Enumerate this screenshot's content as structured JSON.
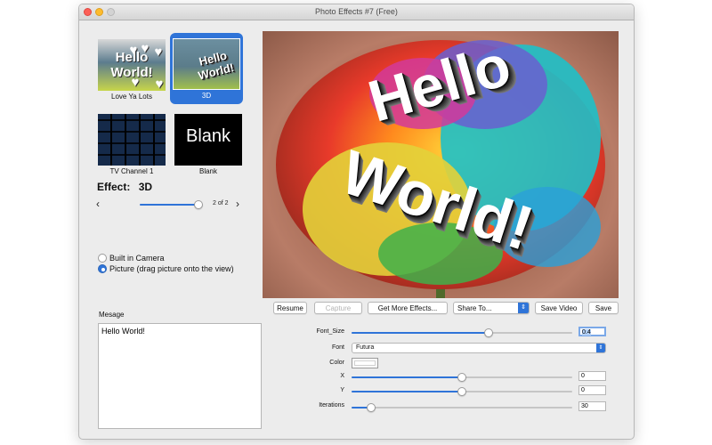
{
  "window": {
    "title": "Photo Effects #7 (Free)"
  },
  "effects": {
    "items": [
      {
        "label": "Love Ya Lots",
        "thumb_text": "Hello World!"
      },
      {
        "label": "3D",
        "thumb_text": "Hello World!"
      },
      {
        "label": "TV Channel 1"
      },
      {
        "label": "Blank",
        "thumb_text": "Blank"
      }
    ],
    "selected_index": 1,
    "current_label": "Effect:",
    "current_value": "3D",
    "counter": "2 of 2",
    "slider_level": 1.0,
    "prev_icon": "chevron-left-icon",
    "next_icon": "chevron-right-icon"
  },
  "source": {
    "options": [
      "Built in Camera",
      "Picture (drag picture onto the view)"
    ],
    "selected_index": 1
  },
  "message": {
    "label": "Mesage",
    "value": "Hello World!"
  },
  "preview": {
    "text_line1": "Hello",
    "text_line2": "World!"
  },
  "toolbar": {
    "resume": "Resume",
    "capture": "Capture",
    "get_more": "Get More Effects...",
    "share": "Share To...",
    "save_video": "Save Video",
    "save": "Save"
  },
  "params": {
    "font_size": {
      "label": "Font_Size",
      "value": "0.4",
      "level": 0.62
    },
    "font": {
      "label": "Font",
      "value": "Futura"
    },
    "color": {
      "label": "Color",
      "value": "#ffffff"
    },
    "x": {
      "label": "X",
      "value": "0",
      "level": 0.5
    },
    "y": {
      "label": "Y",
      "value": "0",
      "level": 0.5
    },
    "iterations": {
      "label": "Iterations",
      "value": "30",
      "level": 0.09
    }
  },
  "colors": {
    "accent": "#2f74d8"
  }
}
